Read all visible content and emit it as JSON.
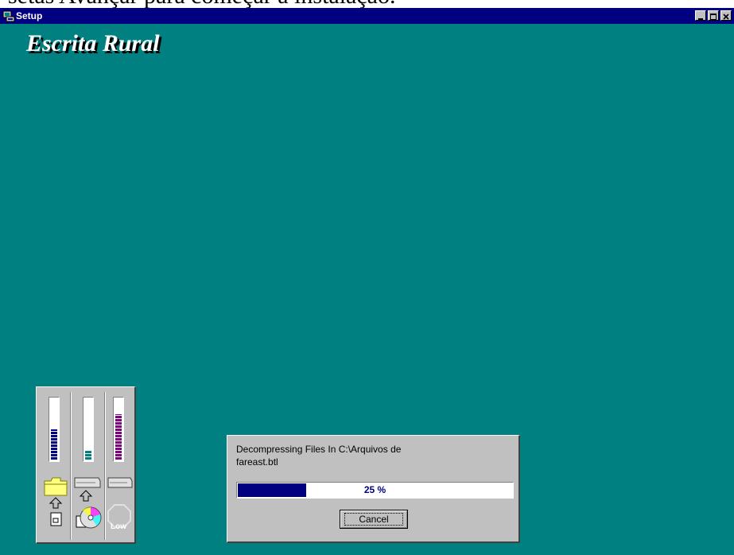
{
  "page": {
    "top_caption": "setas Avançar para começar a instalação."
  },
  "window": {
    "title": "Setup"
  },
  "product": {
    "title": "Escrita Rural"
  },
  "meters": {
    "colors": {
      "disk1": "#000080",
      "disk2": "#008080",
      "memory": "#800080"
    },
    "disk1_level": 0.5,
    "disk2_level": 0.15,
    "memory_level": 0.75,
    "low_label": "Low"
  },
  "dialog": {
    "status_line1": "Decompressing Files In C:\\Arquivos de",
    "status_line2": "fareast.btl",
    "progress_percent": 25,
    "progress_label": "25 %",
    "cancel_label": "Cancel"
  }
}
